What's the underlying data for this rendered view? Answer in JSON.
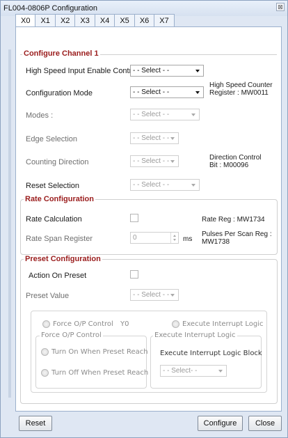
{
  "window": {
    "title": "FL004-0806P Configuration",
    "close_glyph": "⊠"
  },
  "tabs": [
    "X0",
    "X1",
    "X2",
    "X3",
    "X4",
    "X5",
    "X6",
    "X7"
  ],
  "channel": {
    "title": "Configure Channel 1",
    "high_speed_input_label": "High Speed Input Enable Control",
    "high_speed_input_value": "- - Select - -",
    "config_mode_label": "Configuration Mode",
    "config_mode_value": "- - Select - -",
    "hsc_register_line1": "High Speed Counter",
    "hsc_register_line2": "Register : MW0011",
    "modes_label": "Modes :",
    "modes_value": "- - Select - -",
    "edge_label": "Edge Selection",
    "edge_value": "- - Select - -",
    "counting_label": "Counting Direction",
    "counting_value": "- - Select - -",
    "direction_line1": "Direction Control",
    "direction_line2": "Bit : M00096",
    "reset_label": "Reset Selection",
    "reset_value": "- - Select - -"
  },
  "rate": {
    "title": "Rate Configuration",
    "calc_label": "Rate Calculation",
    "rate_reg": "Rate Reg : MW1734",
    "span_label": "Rate Span Register",
    "span_value": "0",
    "span_unit": "ms",
    "pulses_line1": "Pulses Per Scan Reg :",
    "pulses_line2": "MW1738"
  },
  "preset": {
    "title": "Preset Configuration",
    "action_label": "Action On Preset",
    "value_label": "Preset Value",
    "value_select": "- - Select - -",
    "force_radio_label": "Force O/P Control",
    "force_addr": "Y0",
    "interrupt_radio_label": "Execute Interrupt Logic",
    "force_group_title": "Force O/P Control",
    "turn_on_label": "Turn On When Preset Reach",
    "turn_off_label": "Turn Off When Preset Reach",
    "interrupt_group_title": "Execute Interrupt Logic",
    "interrupt_block_label": "Execute Interrupt Logic Block",
    "interrupt_select": "- - Select- -"
  },
  "buttons": {
    "reset": "Reset",
    "configure": "Configure",
    "close": "Close"
  }
}
